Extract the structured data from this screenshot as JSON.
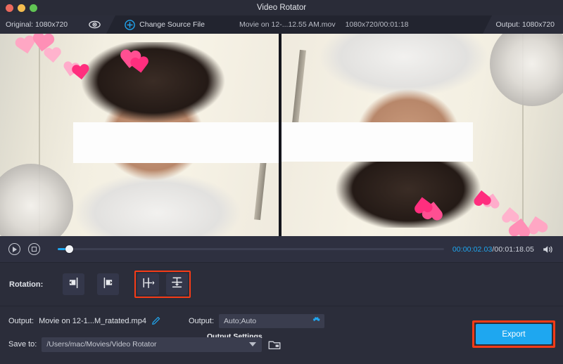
{
  "window": {
    "title": "Video Rotator",
    "controls": [
      "close",
      "minimize",
      "zoom"
    ]
  },
  "toolbar": {
    "original_label": "Original: 1080x720",
    "eye_icon": "eye-icon",
    "plus_icon": "plus-circle-icon",
    "change_source_label": "Change Source File",
    "file_name": "Movie on 12-...12.55 AM.mov",
    "file_info": "1080x720/00:01:18",
    "output_label": "Output: 1080x720"
  },
  "preview": {
    "left_pane_name": "original-preview",
    "right_pane_name": "rotated-preview"
  },
  "player": {
    "play_icon": "play-icon",
    "stop_icon": "stop-icon",
    "current_time": "00:00:02.03",
    "separator": "/",
    "total_time": "00:01:18.05",
    "volume_icon": "volume-icon",
    "progress_percent": 3,
    "accent_color": "#1ea7f0"
  },
  "rotation": {
    "label": "Rotation:",
    "buttons": [
      {
        "name": "rotate-left-button",
        "icon": "rotate-left-icon",
        "selected": false
      },
      {
        "name": "rotate-right-button",
        "icon": "rotate-right-icon",
        "selected": false
      },
      {
        "name": "flip-horizontal-button",
        "icon": "flip-horizontal-icon",
        "selected": true
      },
      {
        "name": "flip-vertical-button",
        "icon": "flip-vertical-icon",
        "selected": true
      }
    ],
    "highlight_color": "#f63b17"
  },
  "bottom": {
    "output_label": "Output:",
    "output_file_name": "Movie on 12-1...M_ratated.mp4",
    "edit_icon": "pencil-icon",
    "output_format_label": "Output:",
    "output_format_value": "Auto;Auto",
    "settings_icon": "gear-icon",
    "tooltip": "Output Settings",
    "save_to_label": "Save to:",
    "save_to_path": "/Users/mac/Movies/Video Rotator",
    "folder_icon": "folder-icon",
    "dropdown_icon": "chevron-down-icon",
    "export_label": "Export"
  }
}
